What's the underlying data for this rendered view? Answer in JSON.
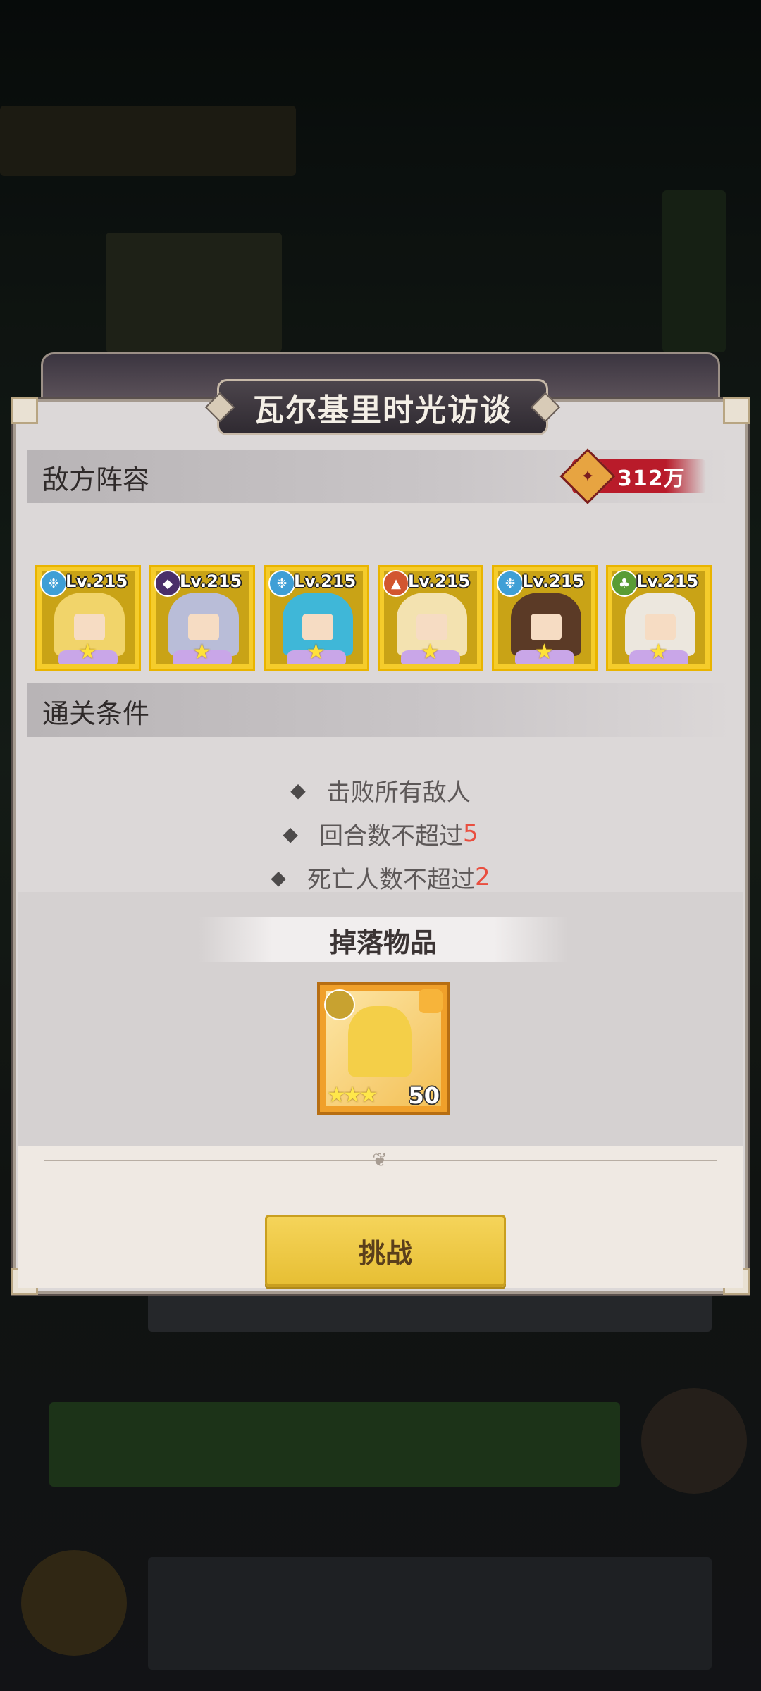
{
  "modal": {
    "title": "瓦尔基里时光访谈",
    "enemy_section": {
      "label": "敌方阵容",
      "power": "312万",
      "heroes": [
        {
          "level": "Lv.215",
          "element_icon": "water-element-icon",
          "element_color": "#3f9fd6",
          "hair_color": "#f1d46a"
        },
        {
          "level": "Lv.215",
          "element_icon": "dark-element-icon",
          "element_color": "#4a2f6a",
          "hair_color": "#b9bdd8"
        },
        {
          "level": "Lv.215",
          "element_icon": "water-element-icon",
          "element_color": "#3f9fd6",
          "hair_color": "#3fb7d8"
        },
        {
          "level": "Lv.215",
          "element_icon": "fire-element-icon",
          "element_color": "#d2562f",
          "hair_color": "#f3e2b0"
        },
        {
          "level": "Lv.215",
          "element_icon": "water-element-icon",
          "element_color": "#3f9fd6",
          "hair_color": "#5b3a26"
        },
        {
          "level": "Lv.215",
          "element_icon": "nature-element-icon",
          "element_color": "#5a9c34",
          "hair_color": "#ece7de"
        }
      ]
    },
    "conditions_section": {
      "label": "通关条件",
      "items": [
        {
          "text": "击败所有敌人",
          "highlight": ""
        },
        {
          "text": "回合数不超过",
          "highlight": "5"
        },
        {
          "text": "死亡人数不超过",
          "highlight": "2"
        }
      ]
    },
    "drops": {
      "label": "掉落物品",
      "item": {
        "count": "50",
        "stars": "★★★",
        "rarity_color": "#f0a02a"
      }
    },
    "challenge_label": "挑战"
  }
}
